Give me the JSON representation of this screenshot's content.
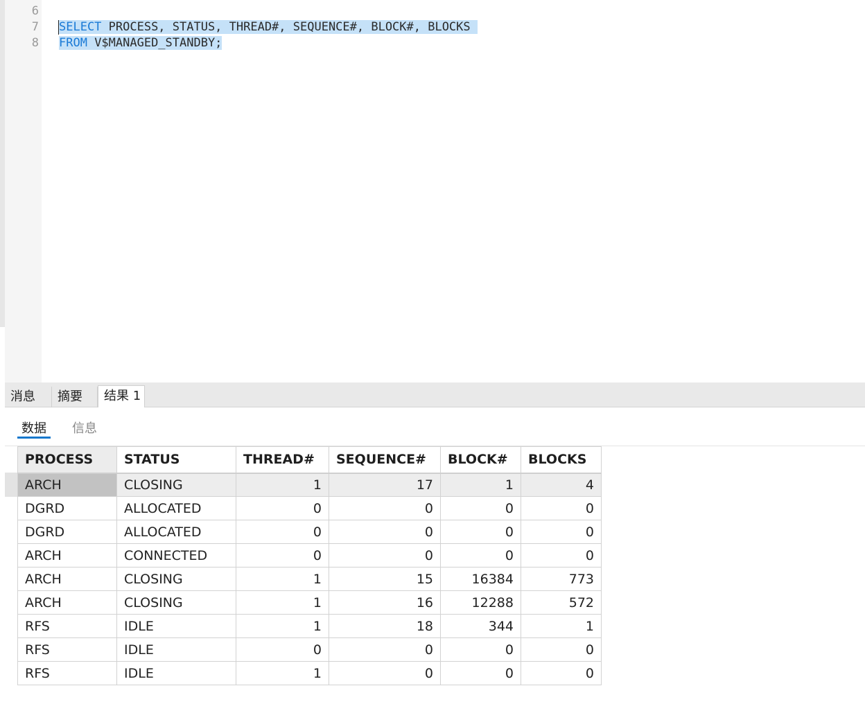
{
  "editor": {
    "line_numbers": [
      "6",
      "7",
      "8"
    ],
    "line7": {
      "kw": "SELECT",
      "rest": " PROCESS, STATUS, THREAD#, SEQUENCE#, BLOCK#, BLOCKS "
    },
    "line8": {
      "kw": "FROM",
      "rest": " V$MANAGED_STANDBY;"
    }
  },
  "result_tabs": [
    "消息",
    "摘要",
    "结果 1"
  ],
  "active_result_tab": "结果 1",
  "sub_tabs": [
    "数据",
    "信息"
  ],
  "active_sub_tab": "数据",
  "grid": {
    "columns": [
      "PROCESS",
      "STATUS",
      "THREAD#",
      "SEQUENCE#",
      "BLOCK#",
      "BLOCKS"
    ],
    "rows": [
      [
        "ARCH",
        "CLOSING",
        "1",
        "17",
        "1",
        "4"
      ],
      [
        "DGRD",
        "ALLOCATED",
        "0",
        "0",
        "0",
        "0"
      ],
      [
        "DGRD",
        "ALLOCATED",
        "0",
        "0",
        "0",
        "0"
      ],
      [
        "ARCH",
        "CONNECTED",
        "0",
        "0",
        "0",
        "0"
      ],
      [
        "ARCH",
        "CLOSING",
        "1",
        "15",
        "16384",
        "773"
      ],
      [
        "ARCH",
        "CLOSING",
        "1",
        "16",
        "12288",
        "572"
      ],
      [
        "RFS",
        "IDLE",
        "1",
        "18",
        "344",
        "1"
      ],
      [
        "RFS",
        "IDLE",
        "0",
        "0",
        "0",
        "0"
      ],
      [
        "RFS",
        "IDLE",
        "1",
        "0",
        "0",
        "0"
      ]
    ]
  },
  "colors": {
    "keyword": "#1a7ad6",
    "selection": "#c5e1f8",
    "accent": "#1677cc"
  }
}
